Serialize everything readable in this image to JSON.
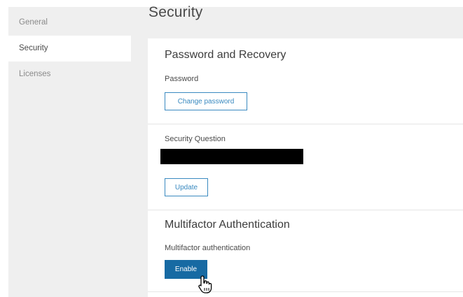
{
  "sidebar": {
    "items": [
      {
        "label": "General"
      },
      {
        "label": "Security",
        "active": true
      },
      {
        "label": "Licenses"
      }
    ]
  },
  "page": {
    "title": "Security"
  },
  "password_recovery": {
    "title": "Password and Recovery",
    "password_label": "Password",
    "change_password_label": "Change password",
    "security_question_label": "Security Question",
    "update_label": "Update"
  },
  "mfa": {
    "title": "Multifactor Authentication",
    "label": "Multifactor authentication",
    "enable_label": "Enable"
  },
  "icons": {
    "pointer": "hand-pointer-icon"
  },
  "colors": {
    "accent": "#176aa3",
    "outline": "#3a8ac0",
    "sidebar_bg": "#efefef"
  }
}
